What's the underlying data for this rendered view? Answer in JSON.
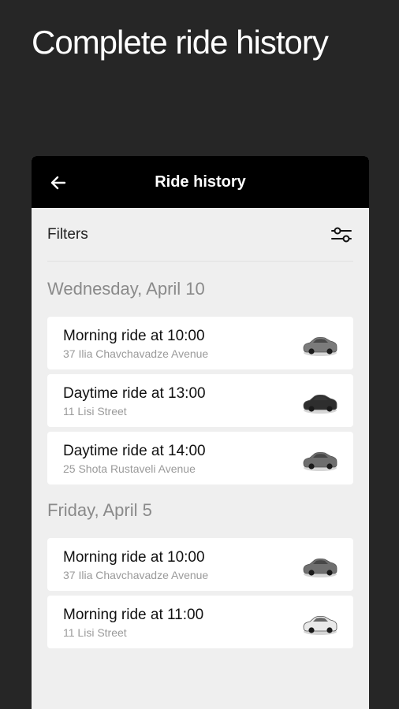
{
  "headline": "Complete ride history",
  "appbar": {
    "title": "Ride history",
    "back_icon": "arrow-left-icon"
  },
  "filters": {
    "label": "Filters",
    "icon": "sliders-icon"
  },
  "sections": [
    {
      "date": "Wednesday, April 10",
      "rides": [
        {
          "title": "Morning ride at 10:00",
          "address": "37 Ilia Chavchavadze Avenue",
          "car_color": "#7b7b7b"
        },
        {
          "title": "Daytime ride at 13:00",
          "address": "11 Lisi Street",
          "car_color": "#2e2e2e"
        },
        {
          "title": "Daytime ride at 14:00",
          "address": "25 Shota Rustaveli Avenue",
          "car_color": "#6e6e6e"
        }
      ]
    },
    {
      "date": "Friday, April 5",
      "rides": [
        {
          "title": "Morning ride at 10:00",
          "address": "37 Ilia Chavchavadze Avenue",
          "car_color": "#6f6f6f"
        },
        {
          "title": "Morning ride at 11:00",
          "address": "11 Lisi Street",
          "car_color": "#e9e9e9"
        }
      ]
    }
  ]
}
